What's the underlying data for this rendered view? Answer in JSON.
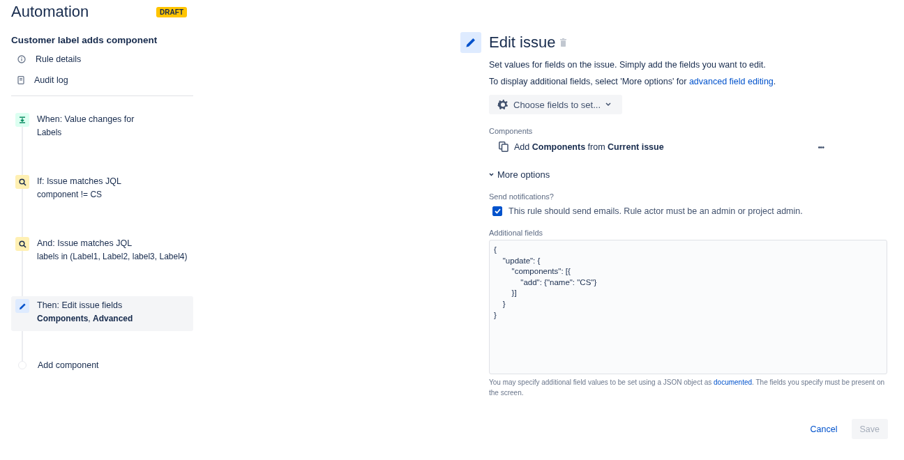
{
  "header": {
    "title": "Automation",
    "badge": "DRAFT"
  },
  "rule": {
    "name": "Customer label adds component",
    "links": [
      {
        "kind": "info",
        "label": "Rule details"
      },
      {
        "kind": "log",
        "label": "Audit log"
      }
    ]
  },
  "steps": [
    {
      "kind": "trigger",
      "title": "When: Value changes for",
      "detail": "Labels",
      "selected": false
    },
    {
      "kind": "condition",
      "title": "If: Issue matches JQL",
      "detail": "component != CS",
      "selected": false
    },
    {
      "kind": "condition",
      "title": "And: Issue matches JQL",
      "detail": "labels in (Label1, Label2, label3, Label4)",
      "selected": false
    },
    {
      "kind": "action",
      "title": "Then: Edit issue fields",
      "detail": "**Components**, **Advanced**",
      "selected": true
    },
    {
      "kind": "add",
      "title": "Add component"
    }
  ],
  "editor": {
    "title": "Edit issue",
    "description": "Set values for fields on the issue. Simply add the fields you want to edit.",
    "hint": {
      "before": "To display additional fields, select 'More options' for ",
      "link": "advanced field editing",
      "after": "."
    },
    "choose_button": "Choose fields to set...",
    "components": {
      "label": "Components",
      "value": "Add **Components** from **Current issue**",
      "menu": "•••"
    },
    "more_options": {
      "label": "More options",
      "expanded": true
    },
    "notifications": {
      "label": "Send notifications?",
      "option": "This rule should send emails. Rule actor must be an admin or project admin.",
      "checked": true
    },
    "additional_fields": {
      "label": "Additional fields",
      "value": "{\n    \"update\": {\n        \"components\": [{\n            \"add\": {\"name\": \"CS\"}\n        }]\n    }\n}",
      "help": {
        "before": "You may specify additional field values to be set using a JSON object as ",
        "link": "documented",
        "after": ". The fields you specify must be present on the screen."
      }
    },
    "buttons": [
      {
        "kind": "cancel",
        "label": "Cancel",
        "disabled": false
      },
      {
        "kind": "save",
        "label": "Save",
        "disabled": true
      }
    ]
  }
}
